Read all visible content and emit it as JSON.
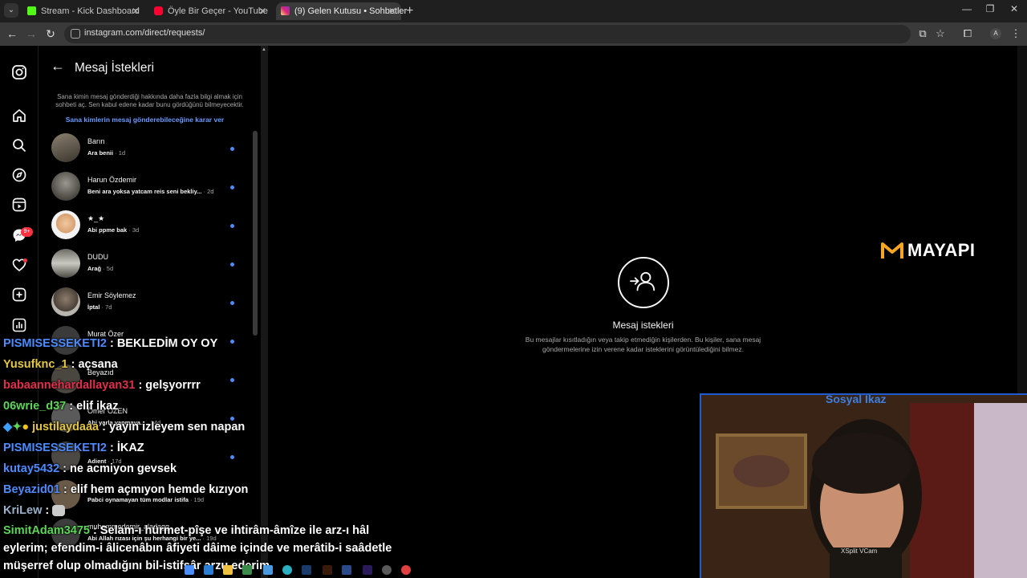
{
  "browser": {
    "tabs": [
      {
        "title": "Stream - Kick Dashboard",
        "favicon_color": "#53fc18"
      },
      {
        "title": "Öyle Bir Geçer - YouTube",
        "favicon_color": "#ff0033"
      },
      {
        "title": "(9) Gelen Kutusu • Sohbetler",
        "favicon_color": "#d6249f"
      }
    ],
    "url": "instagram.com/direct/requests/",
    "profile_initial": "A"
  },
  "rail": {
    "notification_badge": "9+"
  },
  "requests": {
    "title": "Mesaj İstekleri",
    "info": "Sana kimin mesaj gönderdiği hakkında daha fazla bilgi almak için sohbeti aç. Sen kabul edene kadar bunu gördüğünü bilmeyecektir.",
    "link": "Sana kimlerin mesaj gönderebileceğine karar ver",
    "items": [
      {
        "name": "Barın",
        "preview": "Ara benii",
        "time": "· 1d"
      },
      {
        "name": "Harun Özdemir",
        "preview": "Beni ara yoksa yatcam reis seni bekliy...",
        "time": "· 2d"
      },
      {
        "name": "★_★",
        "preview": "Abi ppme bak",
        "time": "· 3d"
      },
      {
        "name": "DUDU",
        "preview": "Arağ",
        "time": "· 5d"
      },
      {
        "name": "Emir Söylemez",
        "preview": "İptal",
        "time": "· 7d"
      },
      {
        "name": "Murat Özer",
        "preview": "",
        "time": ""
      },
      {
        "name": "Beyazıd",
        "preview": "",
        "time": ""
      },
      {
        "name": "Ömer ÖZEN",
        "preview": "Abi yarla yapmaya...",
        "time": "· 14d"
      },
      {
        "name": "",
        "preview": "Adient",
        "time": "· 17d"
      },
      {
        "name": "",
        "preview": "Pabci oynamayan tüm modlar istifa",
        "time": "· 19d"
      },
      {
        "name": "muhammedemir_aladagg",
        "preview": "Abi Allah rızası için şu herhangi bir ye...",
        "time": "· 19d"
      }
    ]
  },
  "empty_state": {
    "title": "Mesaj istekleri",
    "description": "Bu mesajlar kısıtladığın veya takip etmediğin kişilerden. Bu kişiler, sana mesaj göndermelerine izin verene kadar isteklerini görüntülediğini bilmez."
  },
  "overlay": {
    "logo_text": "MAYAPI",
    "cam_title": "Sosyal Ikaz",
    "cam_label": "XSplit VCam"
  },
  "chat": [
    {
      "user": "PISMISESSEKETI2",
      "text": " : BEKLEDİM OY OY",
      "color": "#4d8bff"
    },
    {
      "user": "Yusufknc_1",
      "text": " : açsana",
      "color": "#e3c744"
    },
    {
      "user": "babaannehardallayan31",
      "text": " : gelşyorrrr",
      "color": "#e0304a"
    },
    {
      "user": "06wrie_d37",
      "text": " : elif ikaz",
      "color": "#5cd656"
    },
    {
      "user": "justilaydaaa",
      "text": " : yayın izleyem sen napan",
      "color": "#e3c744"
    },
    {
      "user": "PISMISESSEKETI2",
      "text": " : İKAZ",
      "color": "#4d8bff"
    },
    {
      "user": "kutay5432",
      "text": " : ne acmiyon gevsek",
      "color": "#4d8bff"
    },
    {
      "user": "Beyazid01",
      "text": " : elif hem açmıyon hemde kızıyon",
      "color": "#4d8bff"
    },
    {
      "user": "KriLew",
      "text": " :",
      "color": "#9ab0c8"
    },
    {
      "user": "SimitAdam3475",
      "text": " : Selam-ı hürmet-pîşe ve ihtirâm-âmîze ile arz-ı hâl eylerim; efendim-i âlicenâbın âfiyeti dâime içinde ve merâtib-i saâdetle müşerref olup olmadığını bil-istifsâr arzu ederim",
      "color": "#5cd656"
    }
  ]
}
